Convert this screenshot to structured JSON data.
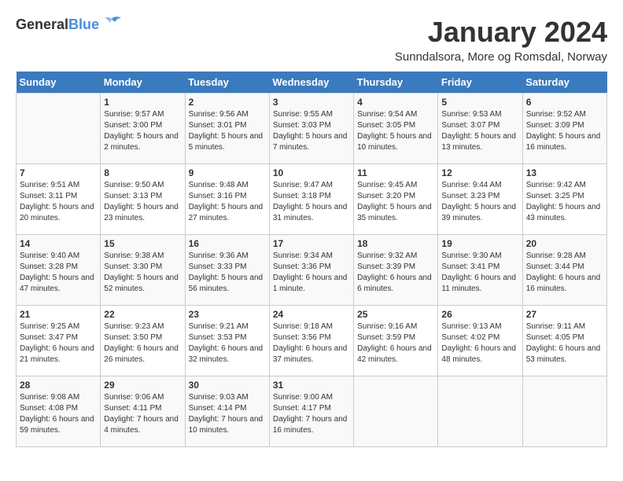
{
  "header": {
    "logo_general": "General",
    "logo_blue": "Blue",
    "month_title": "January 2024",
    "location": "Sunndalsora, More og Romsdal, Norway"
  },
  "weekdays": [
    "Sunday",
    "Monday",
    "Tuesday",
    "Wednesday",
    "Thursday",
    "Friday",
    "Saturday"
  ],
  "weeks": [
    [
      {
        "day": "",
        "sunrise": "",
        "sunset": "",
        "daylight": ""
      },
      {
        "day": "1",
        "sunrise": "Sunrise: 9:57 AM",
        "sunset": "Sunset: 3:00 PM",
        "daylight": "Daylight: 5 hours and 2 minutes."
      },
      {
        "day": "2",
        "sunrise": "Sunrise: 9:56 AM",
        "sunset": "Sunset: 3:01 PM",
        "daylight": "Daylight: 5 hours and 5 minutes."
      },
      {
        "day": "3",
        "sunrise": "Sunrise: 9:55 AM",
        "sunset": "Sunset: 3:03 PM",
        "daylight": "Daylight: 5 hours and 7 minutes."
      },
      {
        "day": "4",
        "sunrise": "Sunrise: 9:54 AM",
        "sunset": "Sunset: 3:05 PM",
        "daylight": "Daylight: 5 hours and 10 minutes."
      },
      {
        "day": "5",
        "sunrise": "Sunrise: 9:53 AM",
        "sunset": "Sunset: 3:07 PM",
        "daylight": "Daylight: 5 hours and 13 minutes."
      },
      {
        "day": "6",
        "sunrise": "Sunrise: 9:52 AM",
        "sunset": "Sunset: 3:09 PM",
        "daylight": "Daylight: 5 hours and 16 minutes."
      }
    ],
    [
      {
        "day": "7",
        "sunrise": "Sunrise: 9:51 AM",
        "sunset": "Sunset: 3:11 PM",
        "daylight": "Daylight: 5 hours and 20 minutes."
      },
      {
        "day": "8",
        "sunrise": "Sunrise: 9:50 AM",
        "sunset": "Sunset: 3:13 PM",
        "daylight": "Daylight: 5 hours and 23 minutes."
      },
      {
        "day": "9",
        "sunrise": "Sunrise: 9:48 AM",
        "sunset": "Sunset: 3:16 PM",
        "daylight": "Daylight: 5 hours and 27 minutes."
      },
      {
        "day": "10",
        "sunrise": "Sunrise: 9:47 AM",
        "sunset": "Sunset: 3:18 PM",
        "daylight": "Daylight: 5 hours and 31 minutes."
      },
      {
        "day": "11",
        "sunrise": "Sunrise: 9:45 AM",
        "sunset": "Sunset: 3:20 PM",
        "daylight": "Daylight: 5 hours and 35 minutes."
      },
      {
        "day": "12",
        "sunrise": "Sunrise: 9:44 AM",
        "sunset": "Sunset: 3:23 PM",
        "daylight": "Daylight: 5 hours and 39 minutes."
      },
      {
        "day": "13",
        "sunrise": "Sunrise: 9:42 AM",
        "sunset": "Sunset: 3:25 PM",
        "daylight": "Daylight: 5 hours and 43 minutes."
      }
    ],
    [
      {
        "day": "14",
        "sunrise": "Sunrise: 9:40 AM",
        "sunset": "Sunset: 3:28 PM",
        "daylight": "Daylight: 5 hours and 47 minutes."
      },
      {
        "day": "15",
        "sunrise": "Sunrise: 9:38 AM",
        "sunset": "Sunset: 3:30 PM",
        "daylight": "Daylight: 5 hours and 52 minutes."
      },
      {
        "day": "16",
        "sunrise": "Sunrise: 9:36 AM",
        "sunset": "Sunset: 3:33 PM",
        "daylight": "Daylight: 5 hours and 56 minutes."
      },
      {
        "day": "17",
        "sunrise": "Sunrise: 9:34 AM",
        "sunset": "Sunset: 3:36 PM",
        "daylight": "Daylight: 6 hours and 1 minute."
      },
      {
        "day": "18",
        "sunrise": "Sunrise: 9:32 AM",
        "sunset": "Sunset: 3:39 PM",
        "daylight": "Daylight: 6 hours and 6 minutes."
      },
      {
        "day": "19",
        "sunrise": "Sunrise: 9:30 AM",
        "sunset": "Sunset: 3:41 PM",
        "daylight": "Daylight: 6 hours and 11 minutes."
      },
      {
        "day": "20",
        "sunrise": "Sunrise: 9:28 AM",
        "sunset": "Sunset: 3:44 PM",
        "daylight": "Daylight: 6 hours and 16 minutes."
      }
    ],
    [
      {
        "day": "21",
        "sunrise": "Sunrise: 9:25 AM",
        "sunset": "Sunset: 3:47 PM",
        "daylight": "Daylight: 6 hours and 21 minutes."
      },
      {
        "day": "22",
        "sunrise": "Sunrise: 9:23 AM",
        "sunset": "Sunset: 3:50 PM",
        "daylight": "Daylight: 6 hours and 26 minutes."
      },
      {
        "day": "23",
        "sunrise": "Sunrise: 9:21 AM",
        "sunset": "Sunset: 3:53 PM",
        "daylight": "Daylight: 6 hours and 32 minutes."
      },
      {
        "day": "24",
        "sunrise": "Sunrise: 9:18 AM",
        "sunset": "Sunset: 3:56 PM",
        "daylight": "Daylight: 6 hours and 37 minutes."
      },
      {
        "day": "25",
        "sunrise": "Sunrise: 9:16 AM",
        "sunset": "Sunset: 3:59 PM",
        "daylight": "Daylight: 6 hours and 42 minutes."
      },
      {
        "day": "26",
        "sunrise": "Sunrise: 9:13 AM",
        "sunset": "Sunset: 4:02 PM",
        "daylight": "Daylight: 6 hours and 48 minutes."
      },
      {
        "day": "27",
        "sunrise": "Sunrise: 9:11 AM",
        "sunset": "Sunset: 4:05 PM",
        "daylight": "Daylight: 6 hours and 53 minutes."
      }
    ],
    [
      {
        "day": "28",
        "sunrise": "Sunrise: 9:08 AM",
        "sunset": "Sunset: 4:08 PM",
        "daylight": "Daylight: 6 hours and 59 minutes."
      },
      {
        "day": "29",
        "sunrise": "Sunrise: 9:06 AM",
        "sunset": "Sunset: 4:11 PM",
        "daylight": "Daylight: 7 hours and 4 minutes."
      },
      {
        "day": "30",
        "sunrise": "Sunrise: 9:03 AM",
        "sunset": "Sunset: 4:14 PM",
        "daylight": "Daylight: 7 hours and 10 minutes."
      },
      {
        "day": "31",
        "sunrise": "Sunrise: 9:00 AM",
        "sunset": "Sunset: 4:17 PM",
        "daylight": "Daylight: 7 hours and 16 minutes."
      },
      {
        "day": "",
        "sunrise": "",
        "sunset": "",
        "daylight": ""
      },
      {
        "day": "",
        "sunrise": "",
        "sunset": "",
        "daylight": ""
      },
      {
        "day": "",
        "sunrise": "",
        "sunset": "",
        "daylight": ""
      }
    ]
  ]
}
